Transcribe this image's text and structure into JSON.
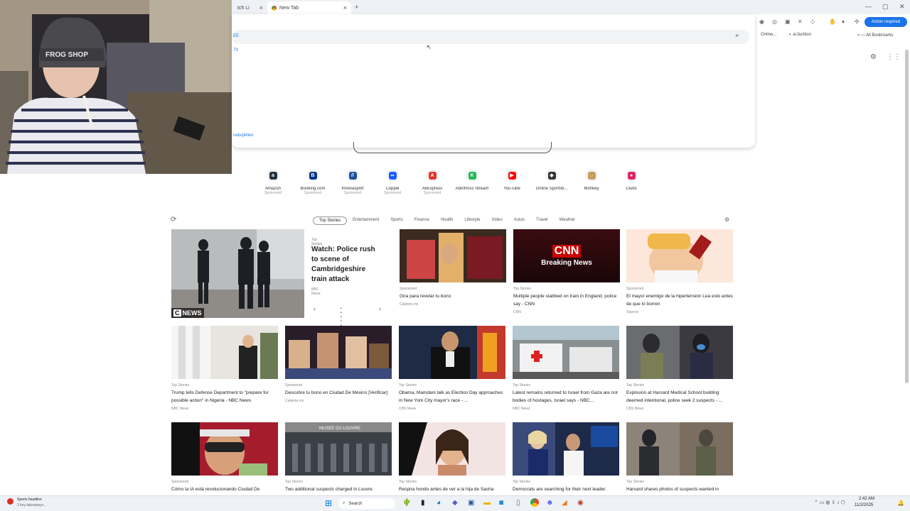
{
  "browser": {
    "tabs": [
      {
        "label": "tch Li"
      },
      {
        "label": "New Tab"
      }
    ],
    "new_tab_symbol": "+",
    "window_controls": [
      "—",
      "▢",
      "✕"
    ],
    "action_required": "Action required",
    "bookmarks": [
      "Online...",
      "ai.fashion",
      "All Bookmarks"
    ]
  },
  "omnibox": {
    "row1": "EE",
    "row2": "73",
    "link": "nals/plinko",
    "clear_icon": "×"
  },
  "shortcuts": [
    {
      "label": "Amazon",
      "sub": "Sponsored",
      "glyph": "a",
      "color": "#232f3e"
    },
    {
      "label": "Booking.com",
      "sub": "Sponsored",
      "glyph": "B",
      "color": "#003580"
    },
    {
      "label": "Innovasport",
      "sub": "Sponsored",
      "glyph": "//",
      "color": "#1b4f9c"
    },
    {
      "label": "Coppel",
      "sub": "Sponsored",
      "glyph": "∞",
      "color": "#1a5cff"
    },
    {
      "label": "AliExpress",
      "sub": "Sponsored",
      "glyph": "A",
      "color": "#e43225"
    },
    {
      "label": "AdinRoss Stream",
      "sub": "",
      "glyph": "K",
      "color": "#1db954"
    },
    {
      "label": "YouTube",
      "sub": "",
      "glyph": "▶",
      "color": "#ff0000"
    },
    {
      "label": "Online Sportsb...",
      "sub": "",
      "glyph": "◈",
      "color": "#333333"
    },
    {
      "label": "Monkey",
      "sub": "",
      "glyph": "🐵",
      "color": "#c8a060"
    },
    {
      "label": "Clubs",
      "sub": "",
      "glyph": "●",
      "color": "#e0245e"
    }
  ],
  "feed": {
    "tabs": [
      "Top Stories",
      "Entertainment",
      "Sports",
      "Finance",
      "Health",
      "Lifestyle",
      "Video",
      "Autos",
      "Travel",
      "Weather"
    ],
    "hero": {
      "source": "Top Stories",
      "title": "Watch: Police rush to scene of Cambridgeshire train attack",
      "publisher": "BBC News",
      "badge": "NEWS",
      "prev": "‹",
      "next": "›",
      "dots": "• • • • •"
    },
    "row1": [
      {
        "source": "Sponsored",
        "title": "Gira para revelar tu bono",
        "publisher": "Caliente.mx"
      },
      {
        "source": "Top Stories",
        "title": "Multiple people stabbed on train in England, police say - CNN",
        "publisher": "CNN"
      },
      {
        "source": "Sponsored",
        "title": "El mayor enemigo de la hipertensión Lea esto antes de que lo borren",
        "publisher": "Topecio"
      }
    ],
    "row2": [
      {
        "source": "Top Stories",
        "title": "Trump tells Defense Department to \"prepare for possible action\" in Nigeria - NBC News",
        "publisher": "NBC News"
      },
      {
        "source": "Sponsored",
        "title": "Descubre tu bono en Ciudad De México [Verificar]",
        "publisher": "Caliente.mx"
      },
      {
        "source": "Top Stories",
        "title": "Obama, Mamdani talk as Election Day approaches in New York City mayor's race - ...",
        "publisher": "CBS News"
      },
      {
        "source": "Top Stories",
        "title": "Latest remains returned to Israel from Gaza are not bodies of hostages, Israel says - NBC...",
        "publisher": "NBC News"
      },
      {
        "source": "Top Stories",
        "title": "Explosion at Harvard Medical School building deemed intentional, police seek 2 suspects - ...",
        "publisher": "CBS News"
      }
    ],
    "row3": [
      {
        "source": "Sponsored",
        "title": "Cómo la IA está revolucionando Ciudad De"
      },
      {
        "source": "Top Stories",
        "title": "Two additional suspects charged in Louvre"
      },
      {
        "source": "Top Stories",
        "title": "Respira hondo antes de ver a la hija de Sasha"
      },
      {
        "source": "Top Stories",
        "title": "Democrats are searching for their next leader."
      },
      {
        "source": "Top Stories",
        "title": "Harvard shares photos of suspects wanted in"
      }
    ],
    "cnn": {
      "logo": "CNN",
      "text": "Breaking News"
    },
    "louvre_sign": "MUSEE DU LOUVRE",
    "webcam_cap": "FROG SHOP"
  },
  "taskbar": {
    "weather_title": "Sports headline",
    "weather_sub": "3 key takeaways...",
    "search": "Search",
    "time": "2:42 AM",
    "date": "11/2/2025"
  },
  "colors": {
    "accent": "#1a73e8",
    "cnn_red": "#cc0000"
  }
}
